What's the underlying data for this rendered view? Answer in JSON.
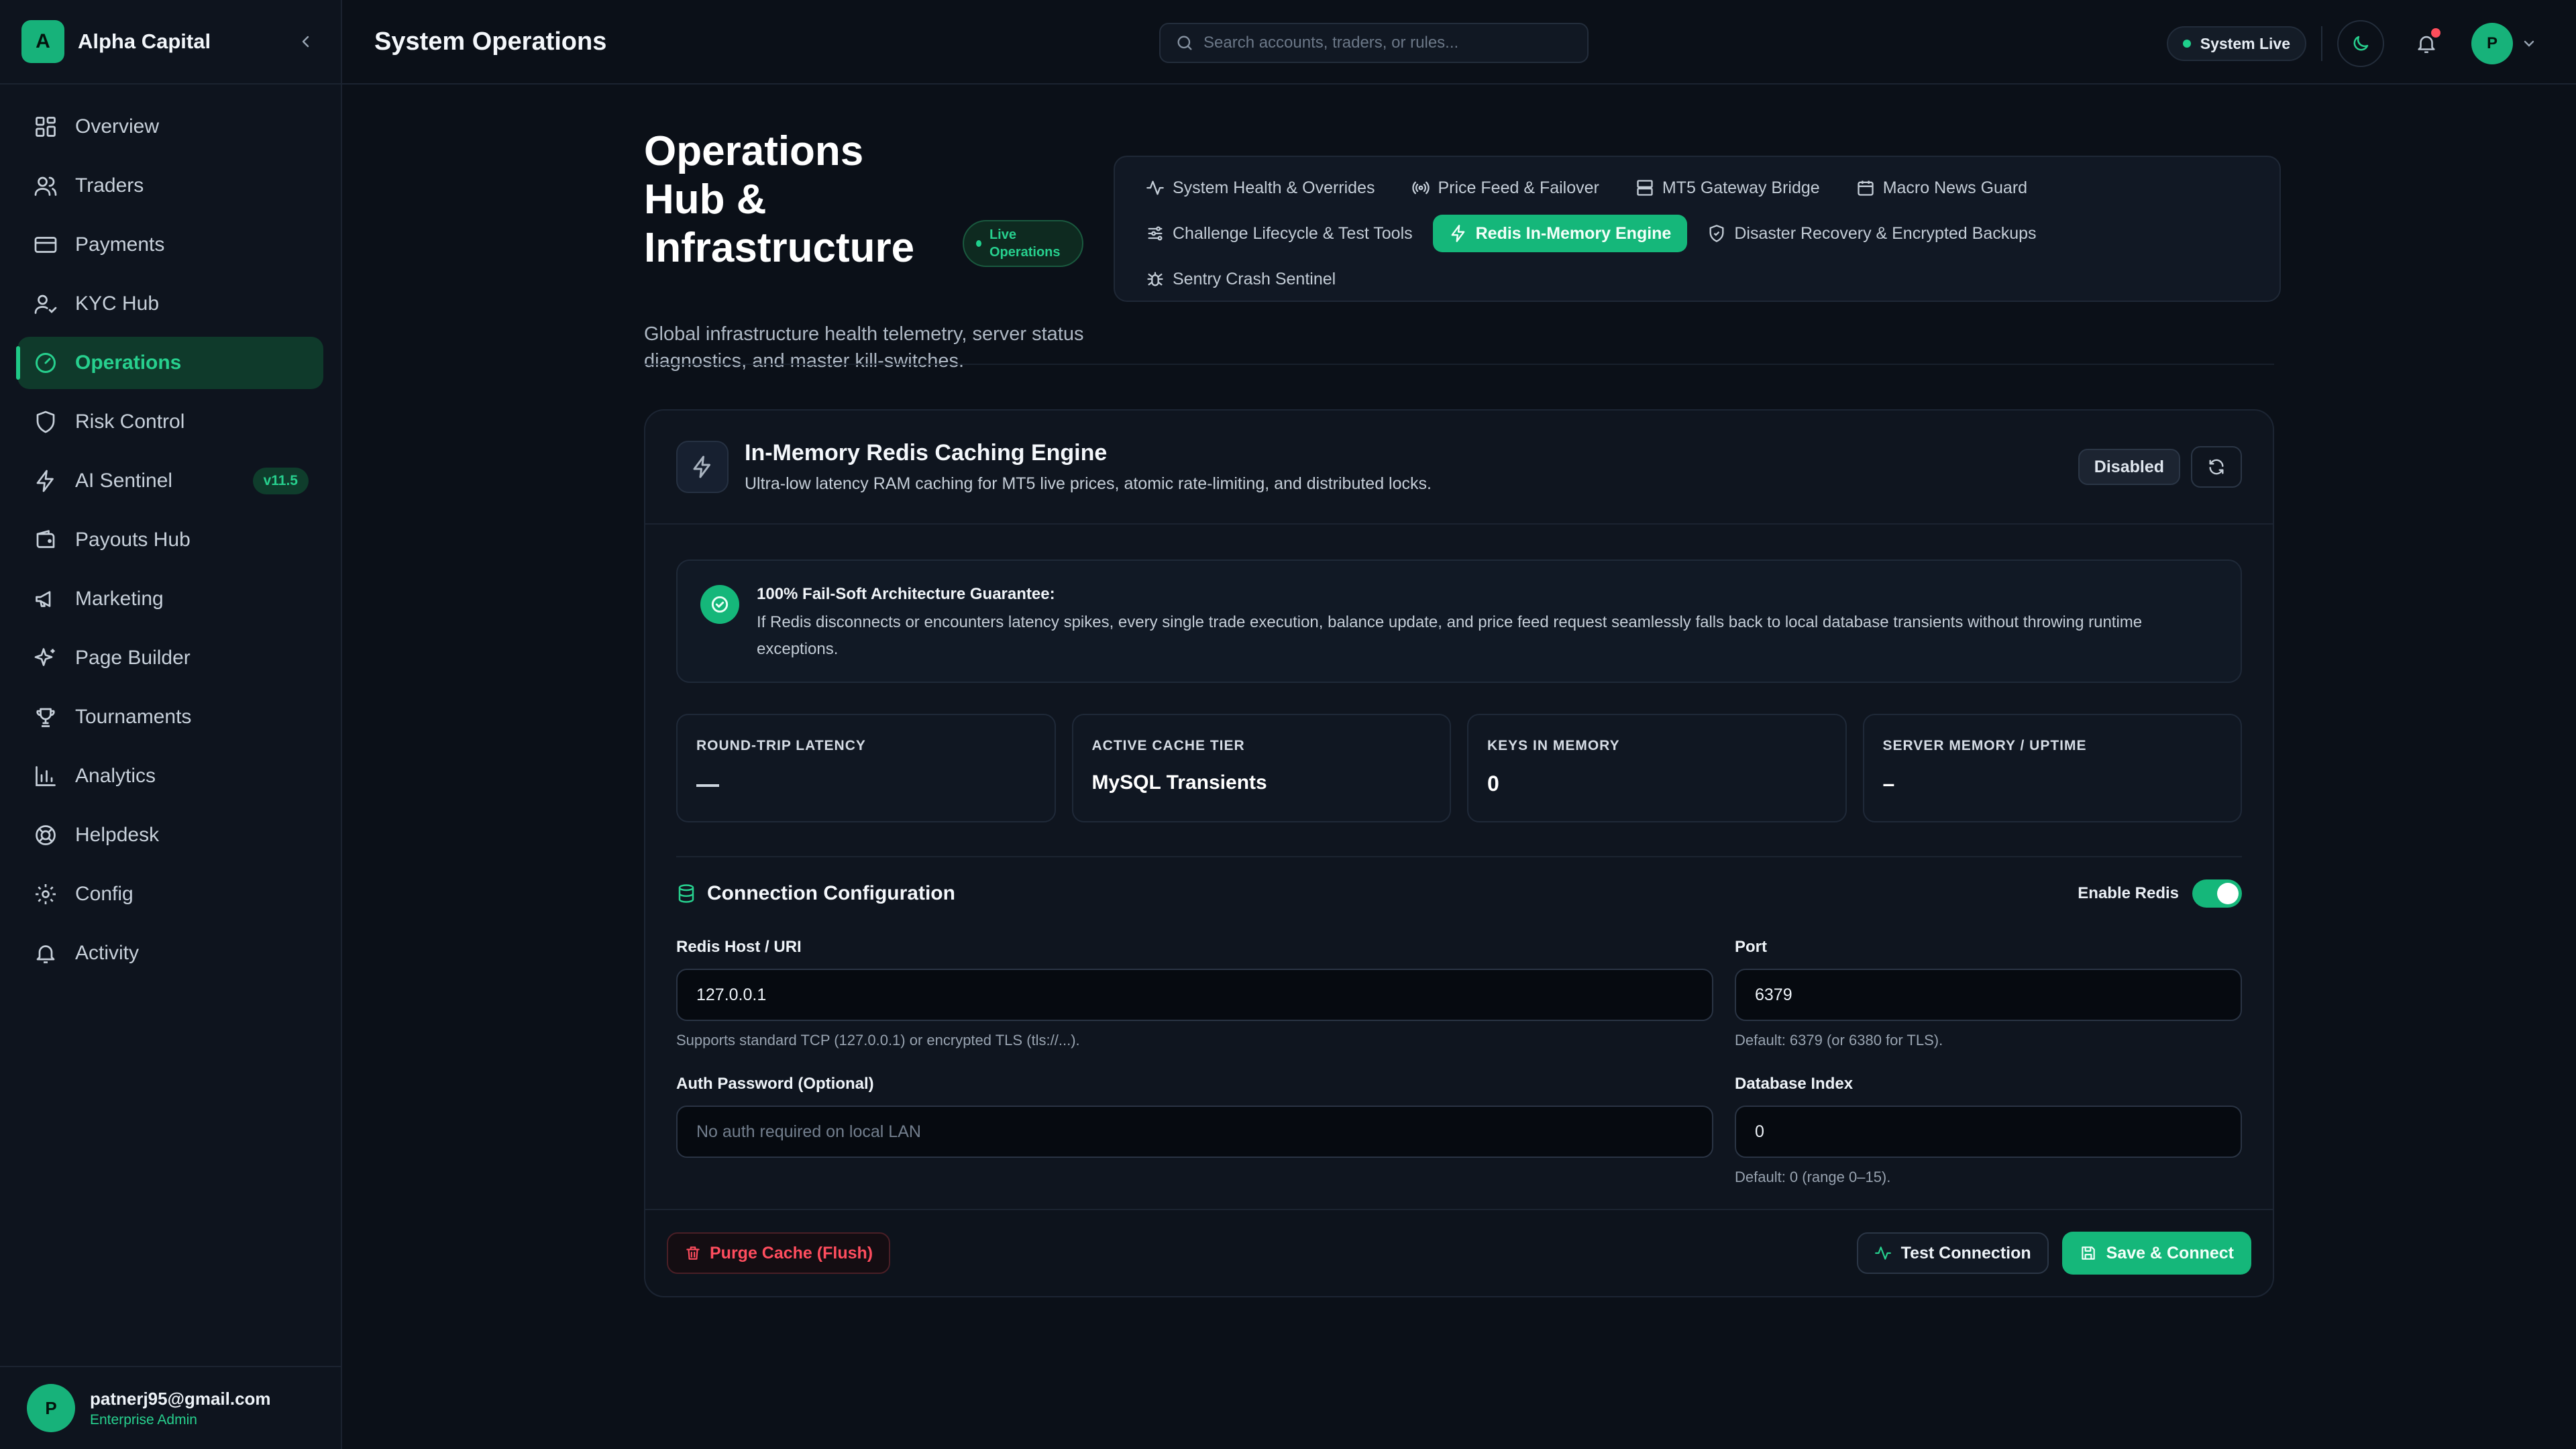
{
  "colors": {
    "accent": "#15b77a",
    "accent_text": "#27d08e",
    "danger": "#ff4d5e",
    "bg": "#0b1018"
  },
  "brand": {
    "logo_letter": "A",
    "name": "Alpha Capital"
  },
  "sidebar": {
    "items": [
      {
        "label": "Overview",
        "icon": "grid-icon"
      },
      {
        "label": "Traders",
        "icon": "users-icon"
      },
      {
        "label": "Payments",
        "icon": "credit-card-icon"
      },
      {
        "label": "KYC Hub",
        "icon": "user-check-icon"
      },
      {
        "label": "Operations",
        "icon": "gauge-icon",
        "active": true
      },
      {
        "label": "Risk Control",
        "icon": "shield-icon"
      },
      {
        "label": "AI Sentinel",
        "icon": "zap-icon",
        "badge": "v11.5"
      },
      {
        "label": "Payouts Hub",
        "icon": "wallet-icon"
      },
      {
        "label": "Marketing",
        "icon": "megaphone-icon"
      },
      {
        "label": "Page Builder",
        "icon": "sparkles-icon"
      },
      {
        "label": "Tournaments",
        "icon": "trophy-icon"
      },
      {
        "label": "Analytics",
        "icon": "bar-chart-icon"
      },
      {
        "label": "Helpdesk",
        "icon": "lifebuoy-icon"
      },
      {
        "label": "Config",
        "icon": "gear-icon"
      },
      {
        "label": "Activity",
        "icon": "bell-icon"
      }
    ]
  },
  "user": {
    "initial": "P",
    "email": "patnerj95@gmail.com",
    "role": "Enterprise Admin"
  },
  "header": {
    "title": "System Operations",
    "search_placeholder": "Search accounts, traders, or rules...",
    "status": "System Live",
    "avatar_initial": "P"
  },
  "page": {
    "title": "Operations Hub & Infrastructure",
    "badge": "Live Operations",
    "subtitle": "Global infrastructure health telemetry, server status diagnostics, and master kill-switches."
  },
  "tabs": [
    {
      "label": "System Health & Overrides",
      "icon": "activity-icon"
    },
    {
      "label": "Price Feed & Failover",
      "icon": "radio-icon"
    },
    {
      "label": "MT5 Gateway Bridge",
      "icon": "server-icon"
    },
    {
      "label": "Macro News Guard",
      "icon": "calendar-icon"
    },
    {
      "label": "Challenge Lifecycle & Test Tools",
      "icon": "sliders-icon"
    },
    {
      "label": "Redis In-Memory Engine",
      "icon": "zap-icon",
      "active": true
    },
    {
      "label": "Disaster Recovery & Encrypted Backups",
      "icon": "shield-check-icon"
    },
    {
      "label": "Sentry Crash Sentinel",
      "icon": "bug-icon"
    }
  ],
  "engine": {
    "title": "In-Memory Redis Caching Engine",
    "subtitle": "Ultra-low latency RAM caching for MT5 live prices, atomic rate-limiting, and distributed locks.",
    "status": "Disabled"
  },
  "guarantee": {
    "title": "100% Fail-Soft Architecture Guarantee:",
    "body": "If Redis disconnects or encounters latency spikes, every single trade execution, balance update, and price feed request seamlessly falls back to local database transients without throwing runtime exceptions."
  },
  "metrics": [
    {
      "label": "ROUND-TRIP LATENCY",
      "value": ""
    },
    {
      "label": "ACTIVE CACHE TIER",
      "value": "MySQL Transients"
    },
    {
      "label": "KEYS IN MEMORY",
      "value": "0"
    },
    {
      "label": "SERVER MEMORY / UPTIME",
      "value": "–"
    }
  ],
  "config": {
    "title": "Connection Configuration",
    "toggle_label": "Enable Redis",
    "toggle_on": true,
    "host": {
      "label": "Redis Host / URI",
      "value": "127.0.0.1",
      "help": "Supports standard TCP (127.0.0.1) or encrypted TLS (tls://...)."
    },
    "port": {
      "label": "Port",
      "value": "6379",
      "help": "Default: 6379 (or 6380 for TLS)."
    },
    "password": {
      "label": "Auth Password (Optional)",
      "value": "",
      "placeholder": "No auth required on local LAN"
    },
    "db_index": {
      "label": "Database Index",
      "value": "0",
      "help": "Default: 0 (range 0–15)."
    }
  },
  "footer": {
    "purge_label": "Purge Cache (Flush)",
    "test_label": "Test Connection",
    "save_label": "Save & Connect"
  }
}
